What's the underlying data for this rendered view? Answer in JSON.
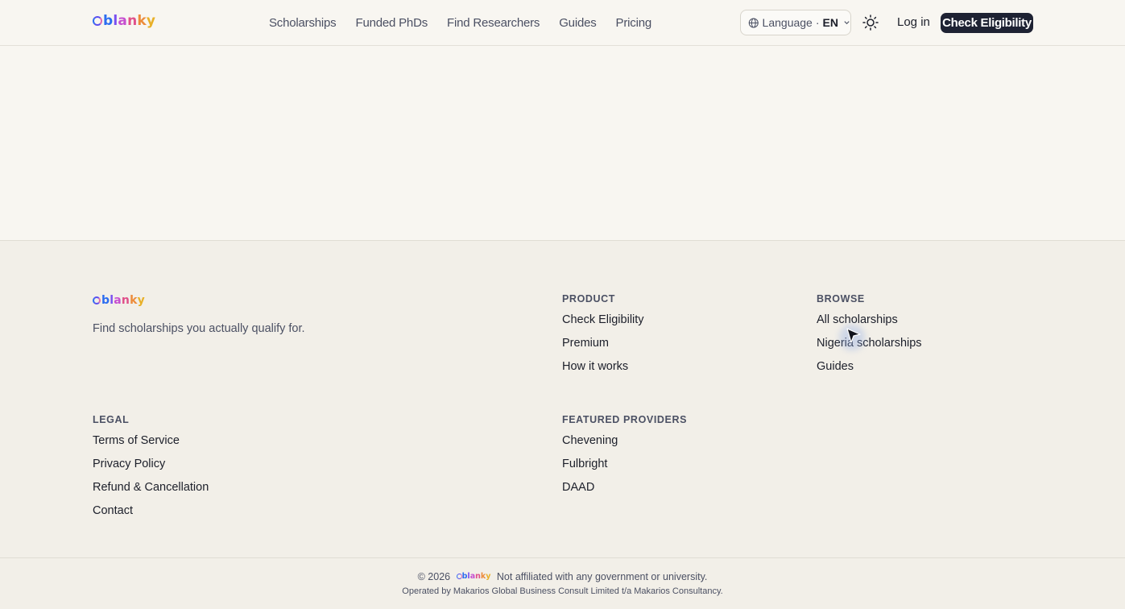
{
  "header": {
    "brand": {
      "letters": [
        "b",
        "l",
        "a",
        "n",
        "k",
        "y"
      ],
      "colors": [
        "#2c6df0",
        "#7a4ff0",
        "#c64fd0",
        "#e0508a",
        "#ec8b3a",
        "#e8b028"
      ]
    },
    "nav": [
      "Scholarships",
      "Funded PhDs",
      "Find Researchers",
      "Guides",
      "Pricing"
    ],
    "language": {
      "label": "Language",
      "separator": "·",
      "code": "EN",
      "icon": "globe-icon"
    },
    "theme_icon": "sun-icon",
    "login": "Log in",
    "cta": "Check Eligibility"
  },
  "footer": {
    "tagline": "Find scholarships you actually qualify for.",
    "product": {
      "title": "PRODUCT",
      "links": [
        "Check Eligibility",
        "Premium",
        "How it works"
      ]
    },
    "browse": {
      "title": "BROWSE",
      "links": [
        "All scholarships",
        "Nigeria scholarships",
        "Guides"
      ]
    },
    "legal": {
      "title": "LEGAL",
      "links": [
        "Terms of Service",
        "Privacy Policy",
        "Refund & Cancellation",
        "Contact"
      ]
    },
    "providers": {
      "title": "FEATURED PROVIDERS",
      "links": [
        "Chevening",
        "Fulbright",
        "DAAD"
      ]
    },
    "copyright": "© 2026",
    "disclaimer": "Not affiliated with any government or university.",
    "operated_by": "Operated by Makarios Global Business Consult Limited t/a Makarios Consultancy."
  },
  "colors": {
    "background": "#f8f6f1",
    "footer_bg": "#f2efe8",
    "cta_bg": "#1e2233",
    "text": "#1c1f2a",
    "muted": "#4b5063"
  }
}
